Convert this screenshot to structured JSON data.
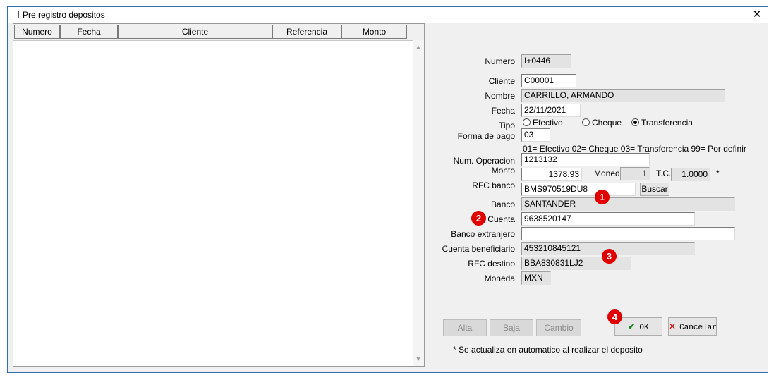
{
  "window": {
    "title": "Pre registro depositos",
    "close_symbol": "✕"
  },
  "grid": {
    "columns": [
      "Numero",
      "Fecha",
      "Cliente",
      "Referencia",
      "Monto"
    ],
    "rows": []
  },
  "form": {
    "numero": {
      "label": "Numero",
      "value": "I+0446"
    },
    "cliente": {
      "label": "Cliente",
      "value": "C00001"
    },
    "nombre": {
      "label": "Nombre",
      "value": "CARRILLO, ARMANDO"
    },
    "fecha": {
      "label": "Fecha",
      "value": "22/11/2021"
    },
    "tipo": {
      "label": "Tipo",
      "options": [
        "Efectivo",
        "Cheque",
        "Transferencia"
      ],
      "selected": "Transferencia"
    },
    "forma_pago": {
      "label": "Forma de pago",
      "value": "03",
      "hint": "01= Efectivo  02= Cheque  03= Transferencia  99= Por definir"
    },
    "num_operacion": {
      "label": "Num. Operacion",
      "value": "1213132"
    },
    "monto": {
      "label": "Monto",
      "value": "1378.93"
    },
    "moneda_num": {
      "label": "Moned",
      "value": "1"
    },
    "tc": {
      "label": "T.C.",
      "value": "1.0000",
      "note": "*"
    },
    "rfc_banco": {
      "label": "RFC banco",
      "value": "BMS970519DU8",
      "search_label": "Buscar"
    },
    "banco": {
      "label": "Banco",
      "value": "SANTANDER"
    },
    "cuenta": {
      "label": "Cuenta",
      "value": "9638520147"
    },
    "banco_extranjero": {
      "label": "Banco extranjero",
      "value": ""
    },
    "cuenta_beneficiario": {
      "label": "Cuenta beneficiario",
      "value": "453210845121"
    },
    "rfc_destino": {
      "label": "RFC destino",
      "value": "BBA830831LJ2"
    },
    "moneda": {
      "label": "Moneda",
      "value": "MXN"
    }
  },
  "buttons": {
    "alta": "Alta",
    "baja": "Baja",
    "cambio": "Cambio",
    "ok": "OK",
    "cancelar": "Cancelar"
  },
  "footnote": "* Se actualiza en automatico al realizar el deposito",
  "markers": [
    "1",
    "2",
    "3",
    "4"
  ],
  "colors": {
    "marker": "#e00000",
    "ok_check": "#1a8a1a",
    "cancel_x": "#cc0000",
    "window_border": "#2f6fb0"
  }
}
